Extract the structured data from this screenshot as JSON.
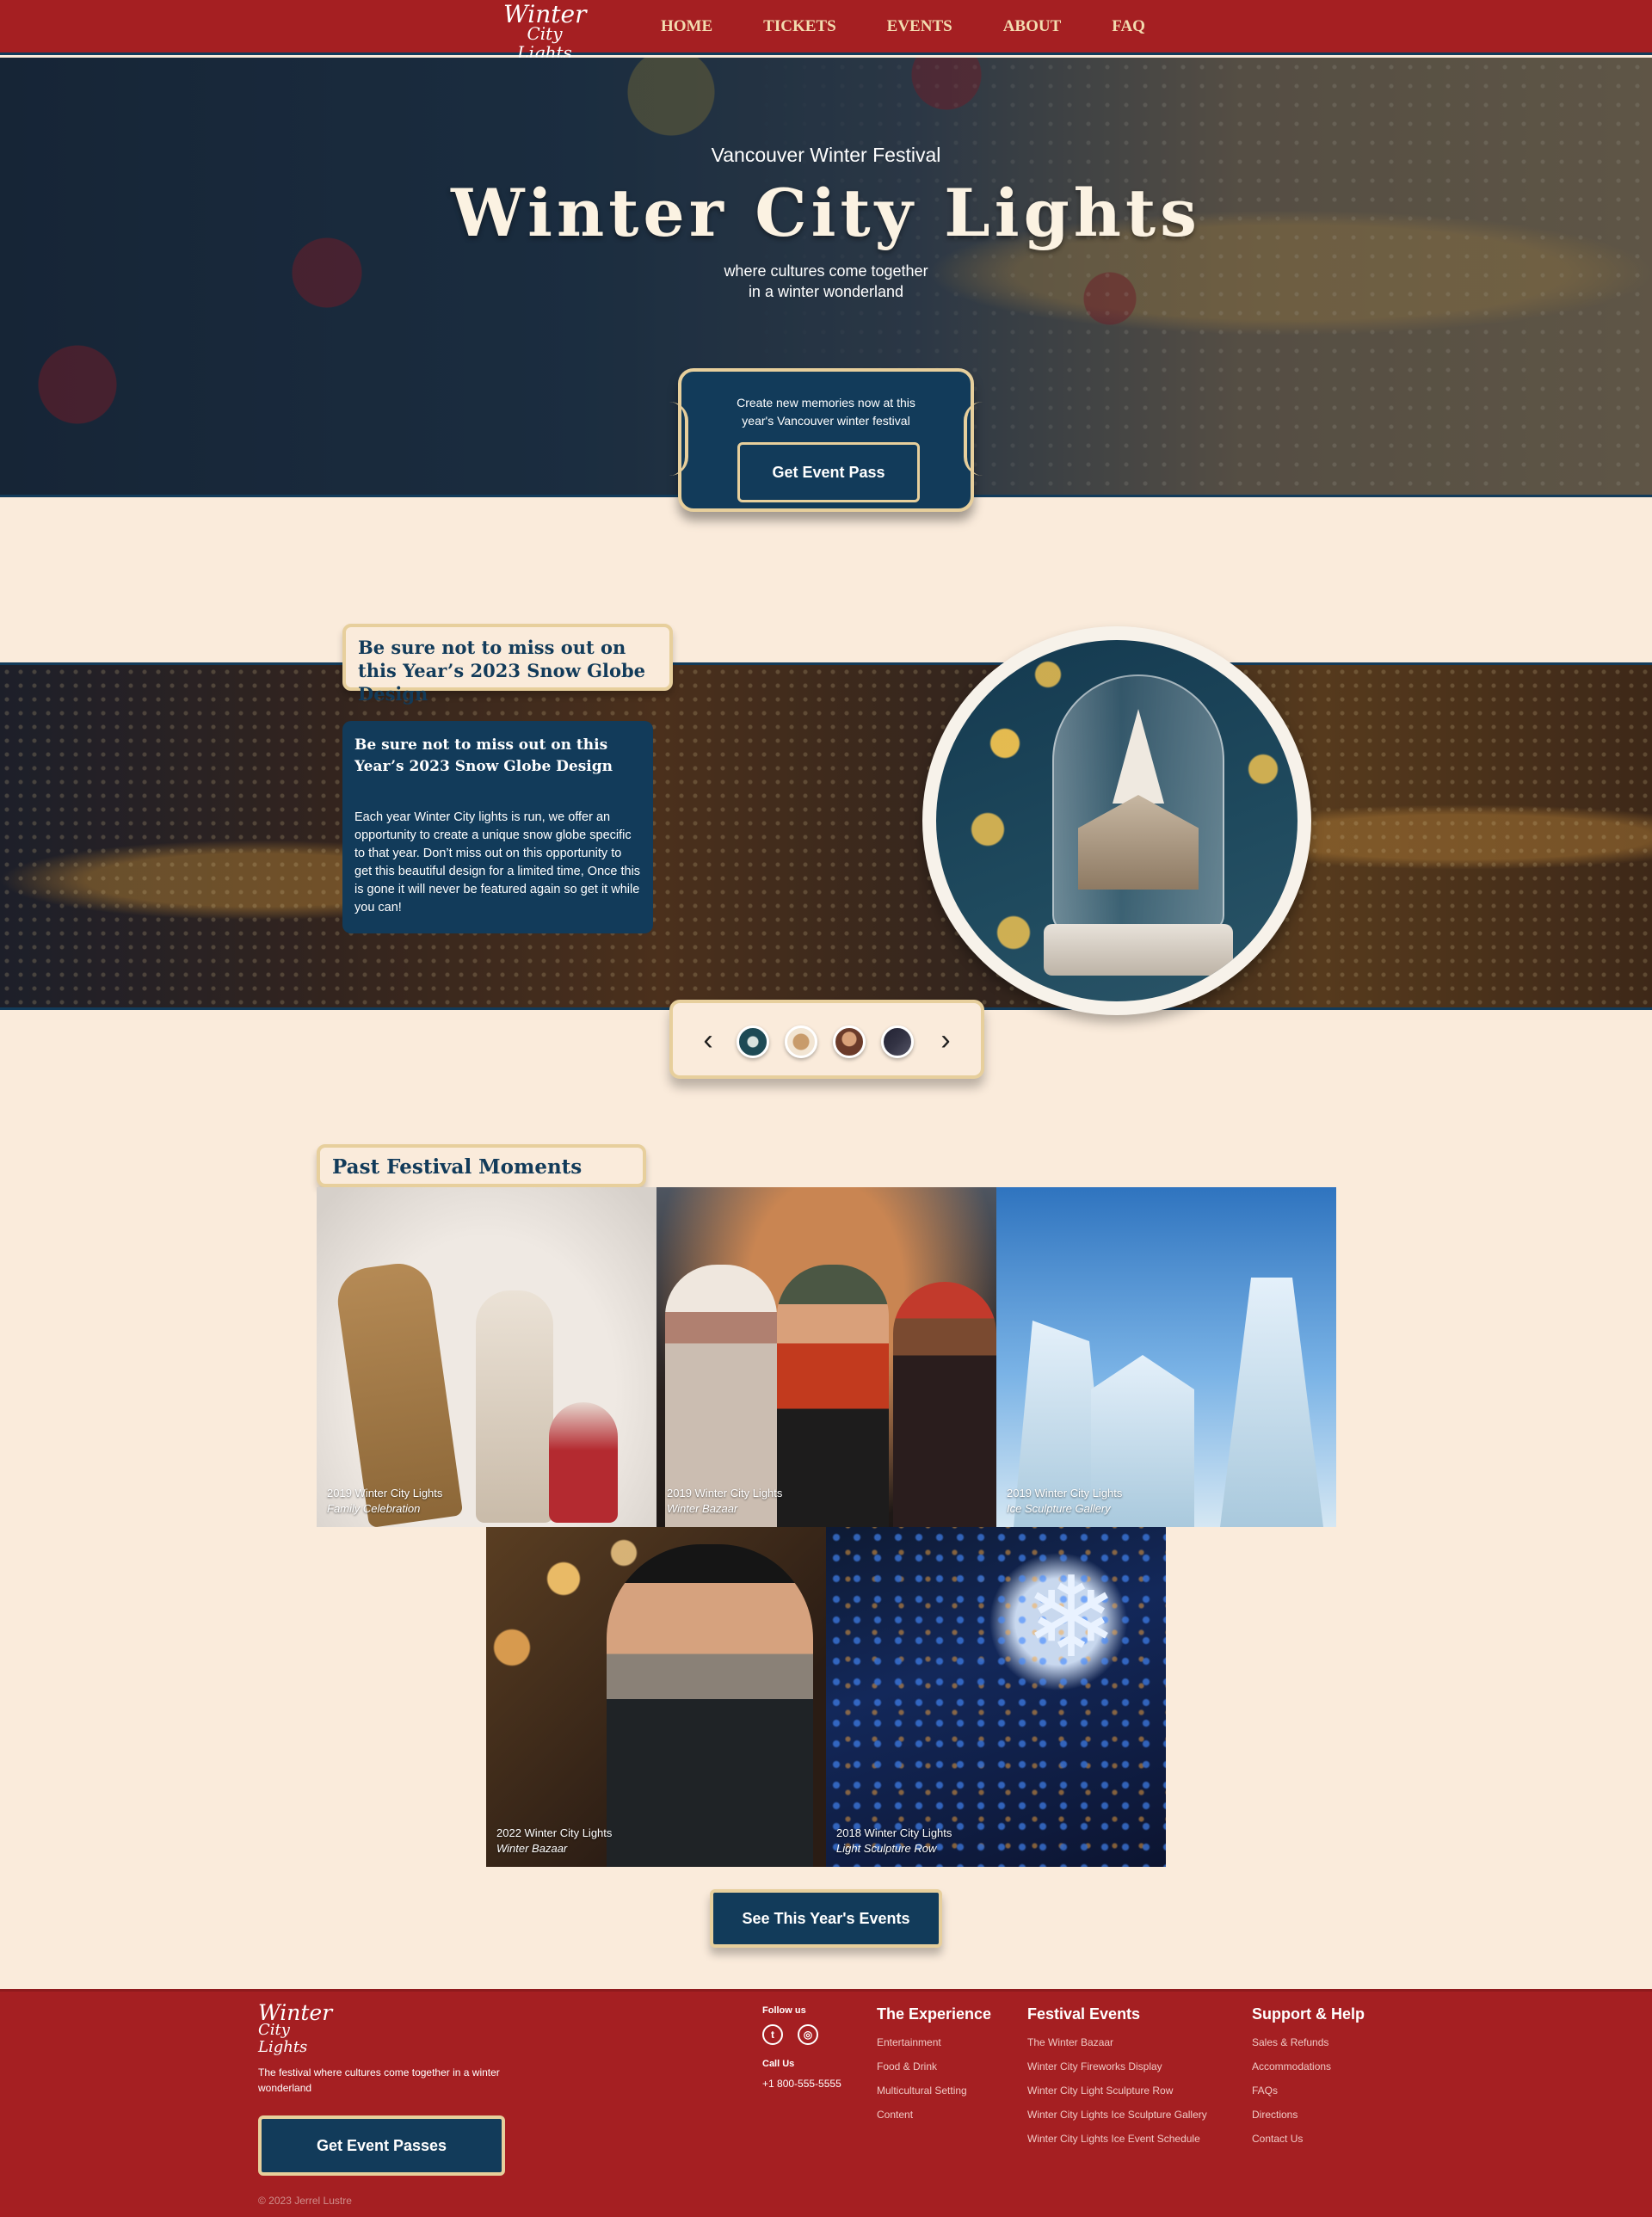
{
  "nav": {
    "logo_line1": "Winter",
    "logo_line2": "City Lights",
    "items": [
      "HOME",
      "TICKETS",
      "EVENTS",
      "ABOUT",
      "FAQ"
    ]
  },
  "hero": {
    "kicker": "Vancouver Winter Festival",
    "title": "Winter City Lights",
    "subtitle_line1": "where cultures come together",
    "subtitle_line2": "in a winter wonderland"
  },
  "ticket": {
    "text_line1": "Create new memories now at this",
    "text_line2": "year's Vancouver winter festival",
    "button": "Get Event Pass"
  },
  "snow_globe": {
    "tag": "Be sure not to miss out on this Year’s 2023 Snow Globe Design",
    "card_title": "Be sure not to miss out on this Year’s 2023 Snow Globe Design",
    "card_text": "Each year Winter City lights is run, we offer an opportunity to create a unique snow globe specific to that year. Don’t miss out on this opportunity to get this beautiful design for a limited time, Once this is gone it will never be featured again so get it while you can!"
  },
  "carousel": {
    "prev_icon": "chevron-left-icon",
    "next_icon": "chevron-right-icon",
    "prev_glyph": "‹",
    "next_glyph": "›"
  },
  "past": {
    "title": "Past Festival Moments",
    "photos": [
      {
        "year": "2019 Winter City Lights",
        "name": "Family Celebration"
      },
      {
        "year": "2019 Winter City Lights",
        "name": "Winter Bazaar"
      },
      {
        "year": "2019 Winter City Lights",
        "name": "Ice Sculpture Gallery"
      },
      {
        "year": "2022 Winter City Lights",
        "name": "Winter Bazaar"
      },
      {
        "year": "2018 Winter City Lights",
        "name": "Light Sculpture Row"
      }
    ],
    "button": "See This Year's Events"
  },
  "footer": {
    "logo_line1": "Winter",
    "logo_line2": "City Lights",
    "tagline": "The festival where cultures come together in a winter wonderland",
    "button": "Get Event Passes",
    "copyright": "© 2023 Jerrel Lustre",
    "follow": "Follow us",
    "social": [
      "twitter-icon",
      "instagram-icon"
    ],
    "call": "Call Us",
    "phone": "+1 800-555-5555",
    "columns": [
      {
        "title": "The Experience",
        "links": [
          "Entertainment",
          "Food & Drink",
          "Multicultural Setting",
          "Content"
        ]
      },
      {
        "title": "Festival Events",
        "links": [
          "The Winter Bazaar",
          "Winter City Fireworks Display",
          "Winter City Light Sculpture Row",
          "Winter City Lights Ice Sculpture Gallery",
          "Winter City Lights Ice Event Schedule"
        ]
      },
      {
        "title": "Support & Help",
        "links": [
          "Sales & Refunds",
          "Accommodations",
          "FAQs",
          "Directions",
          "Contact Us"
        ]
      }
    ]
  },
  "colors": {
    "brand_red": "#a51f22",
    "navy": "#123b5a",
    "cream": "#faebdb",
    "gold": "#e7cf9c"
  }
}
